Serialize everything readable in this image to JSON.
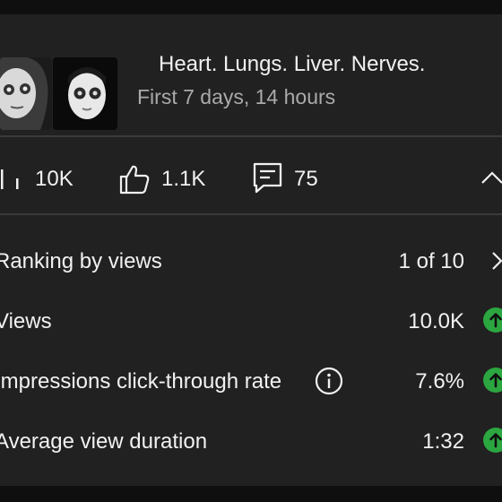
{
  "video": {
    "title": "Heart. Lungs. Liver. Nerves.",
    "subtitle": "First 7 days, 14 hours"
  },
  "stats": {
    "views": "10K",
    "likes": "1.1K",
    "comments": "75"
  },
  "metrics": [
    {
      "label": "Ranking by views",
      "value": "1 of 10",
      "indicator": "chevron-right-icon"
    },
    {
      "label": "Views",
      "value": "10.0K",
      "indicator": "trend-up-icon"
    },
    {
      "label": "Impressions click-through rate",
      "value": "7.6%",
      "indicator": "trend-up-icon",
      "info": true
    },
    {
      "label": "Average view duration",
      "value": "1:32",
      "indicator": "trend-up-icon"
    }
  ],
  "colors": {
    "background": "#0f0f0f",
    "card": "#212121",
    "text_primary": "#f1f1f1",
    "text_secondary": "#aaaaaa",
    "trend_up": "#2ba640"
  }
}
